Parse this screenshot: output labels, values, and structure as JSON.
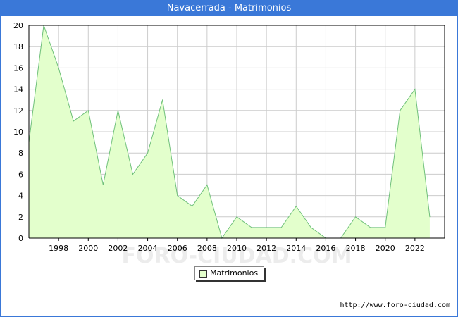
{
  "chart_data": {
    "type": "area",
    "title": "Navacerrada - Matrimonios",
    "xlabel": "",
    "ylabel": "",
    "x": [
      1996,
      1997,
      1998,
      1999,
      2000,
      2001,
      2002,
      2003,
      2004,
      2005,
      2006,
      2007,
      2008,
      2009,
      2010,
      2011,
      2012,
      2013,
      2014,
      2015,
      2016,
      2017,
      2018,
      2019,
      2020,
      2021,
      2022,
      2023
    ],
    "series": [
      {
        "name": "Matrimonios",
        "values": [
          9,
          20,
          16,
          11,
          12,
          5,
          12,
          6,
          8,
          13,
          4,
          3,
          5,
          0,
          2,
          1,
          1,
          1,
          3,
          1,
          0,
          0,
          2,
          1,
          1,
          12,
          14,
          2
        ]
      }
    ],
    "xlim": [
      1996,
      2024
    ],
    "ylim": [
      0,
      20
    ],
    "yticks": [
      0,
      2,
      4,
      6,
      8,
      10,
      12,
      14,
      16,
      18,
      20
    ],
    "xticks": [
      1998,
      2000,
      2002,
      2004,
      2006,
      2008,
      2010,
      2012,
      2014,
      2016,
      2018,
      2020,
      2022
    ],
    "grid": true,
    "legend_position": "bottom-center",
    "watermark": "FORO-CIUDAD.COM",
    "colors": {
      "fill": "#e3ffcc",
      "line": "#6fc07a",
      "grid": "#cccccc",
      "title_bar": "#3a78d8"
    }
  },
  "source_text": "http://www.foro-ciudad.com"
}
